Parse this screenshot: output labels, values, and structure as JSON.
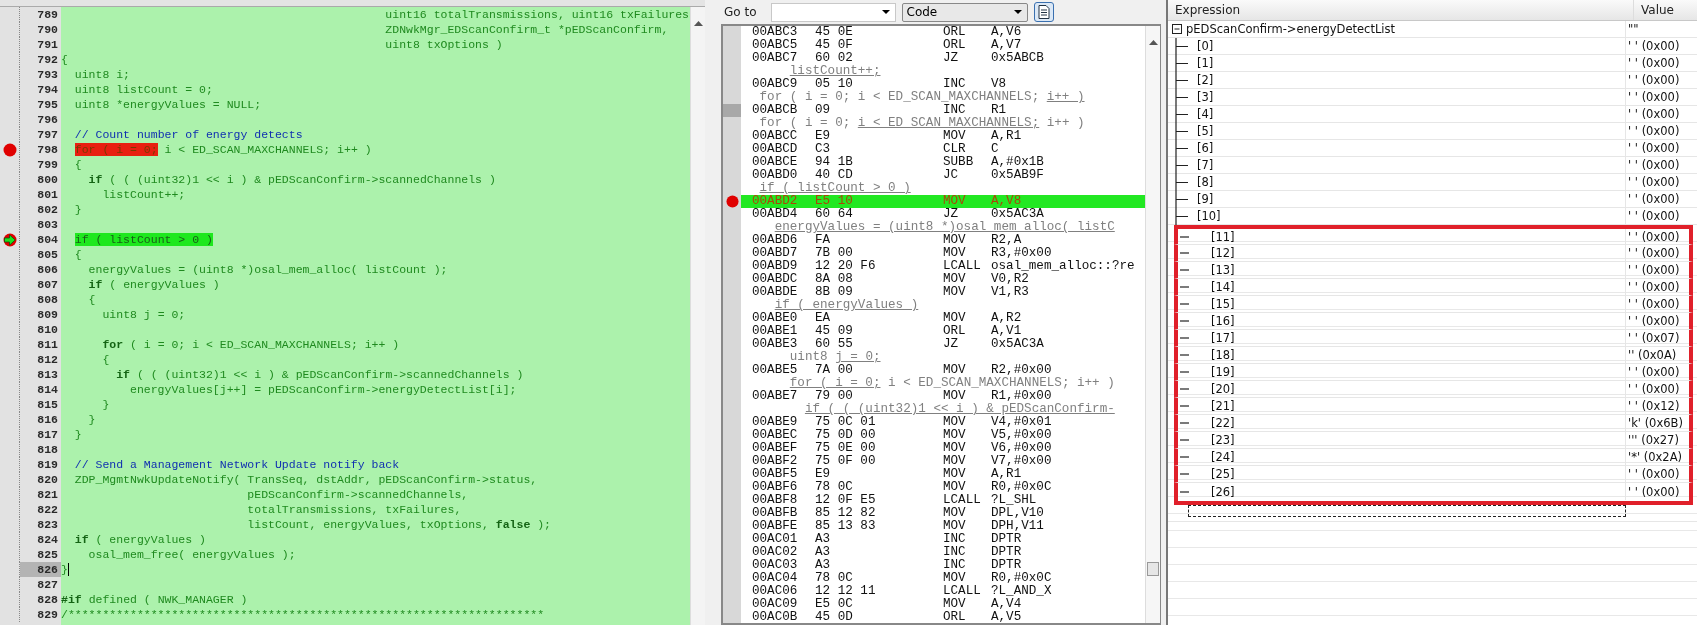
{
  "code": {
    "lines": [
      {
        "number": "789",
        "breakpoint": false,
        "current": false,
        "cursor": false,
        "segments": [
          {
            "kind": "plain",
            "text": "                                               uint16 totalTransmissions, uint16 txFailures"
          }
        ]
      },
      {
        "number": "790",
        "breakpoint": false,
        "current": false,
        "cursor": false,
        "segments": [
          {
            "kind": "plain",
            "text": "                                               ZDNwkMgr_EDScanConfirm_t *pEDScanConfirm,"
          }
        ]
      },
      {
        "number": "791",
        "breakpoint": false,
        "current": false,
        "cursor": false,
        "segments": [
          {
            "kind": "plain",
            "text": "                                               uint8 txOptions )"
          }
        ]
      },
      {
        "number": "792",
        "breakpoint": false,
        "current": false,
        "cursor": false,
        "segments": [
          {
            "kind": "plain",
            "text": "{"
          }
        ]
      },
      {
        "number": "793",
        "breakpoint": false,
        "current": false,
        "cursor": false,
        "segments": [
          {
            "kind": "plain",
            "text": "  uint8 i;"
          }
        ]
      },
      {
        "number": "794",
        "breakpoint": false,
        "current": false,
        "cursor": false,
        "segments": [
          {
            "kind": "plain",
            "text": "  uint8 listCount = 0;"
          }
        ]
      },
      {
        "number": "795",
        "breakpoint": false,
        "current": false,
        "cursor": false,
        "segments": [
          {
            "kind": "plain",
            "text": "  uint8 *energyValues = NULL;"
          }
        ]
      },
      {
        "number": "796",
        "breakpoint": false,
        "current": false,
        "cursor": false
      },
      {
        "number": "797",
        "breakpoint": false,
        "current": false,
        "cursor": false,
        "segments": [
          {
            "kind": "comment",
            "text": "  // Count number of energy detects"
          }
        ]
      },
      {
        "number": "798",
        "breakpoint": true,
        "current": false,
        "cursor": false,
        "segments": [
          {
            "kind": "breakpoint",
            "text": "  for ( i = 0;"
          },
          {
            "kind": "plain",
            "text": " i < ED_SCAN_MAXCHANNELS; i++ )"
          }
        ]
      },
      {
        "number": "799",
        "breakpoint": false,
        "current": false,
        "cursor": false,
        "segments": [
          {
            "kind": "plain",
            "text": "  {"
          }
        ]
      },
      {
        "number": "800",
        "breakpoint": false,
        "current": false,
        "cursor": false,
        "segments": [
          {
            "kind": "keyword",
            "text": "    if"
          },
          {
            "kind": "plain",
            "text": " ( ( (uint32)1 << i ) & pEDScanConfirm->scannedChannels )"
          }
        ]
      },
      {
        "number": "801",
        "breakpoint": false,
        "current": false,
        "cursor": false,
        "segments": [
          {
            "kind": "plain",
            "text": "      listCount++;"
          }
        ]
      },
      {
        "number": "802",
        "breakpoint": false,
        "current": false,
        "cursor": false,
        "segments": [
          {
            "kind": "plain",
            "text": "  }"
          }
        ]
      },
      {
        "number": "803",
        "breakpoint": false,
        "current": false,
        "cursor": false
      },
      {
        "number": "804",
        "breakpoint": true,
        "current": true,
        "cursor": false,
        "segments": [
          {
            "kind": "current",
            "text": "  if ( listCount > 0 )"
          }
        ]
      },
      {
        "number": "805",
        "breakpoint": false,
        "current": false,
        "cursor": false,
        "segments": [
          {
            "kind": "plain",
            "text": "  {"
          }
        ]
      },
      {
        "number": "806",
        "breakpoint": false,
        "current": false,
        "cursor": false,
        "segments": [
          {
            "kind": "plain",
            "text": "    energyValues = (uint8 *)osal_mem_alloc( listCount );"
          }
        ]
      },
      {
        "number": "807",
        "breakpoint": false,
        "current": false,
        "cursor": false,
        "segments": [
          {
            "kind": "keyword",
            "text": "    if"
          },
          {
            "kind": "plain",
            "text": " ( energyValues )"
          }
        ]
      },
      {
        "number": "808",
        "breakpoint": false,
        "current": false,
        "cursor": false,
        "segments": [
          {
            "kind": "plain",
            "text": "    {"
          }
        ]
      },
      {
        "number": "809",
        "breakpoint": false,
        "current": false,
        "cursor": false,
        "segments": [
          {
            "kind": "plain",
            "text": "      uint8 j = 0;"
          }
        ]
      },
      {
        "number": "810",
        "breakpoint": false,
        "current": false,
        "cursor": false
      },
      {
        "number": "811",
        "breakpoint": false,
        "current": false,
        "cursor": false,
        "segments": [
          {
            "kind": "keyword",
            "text": "      for"
          },
          {
            "kind": "plain",
            "text": " ( i = 0; i < ED_SCAN_MAXCHANNELS; i++ )"
          }
        ]
      },
      {
        "number": "812",
        "breakpoint": false,
        "current": false,
        "cursor": false,
        "segments": [
          {
            "kind": "plain",
            "text": "      {"
          }
        ]
      },
      {
        "number": "813",
        "breakpoint": false,
        "current": false,
        "cursor": false,
        "segments": [
          {
            "kind": "keyword",
            "text": "        if"
          },
          {
            "kind": "plain",
            "text": " ( ( (uint32)1 << i ) & pEDScanConfirm->scannedChannels )"
          }
        ]
      },
      {
        "number": "814",
        "breakpoint": false,
        "current": false,
        "cursor": false,
        "segments": [
          {
            "kind": "plain",
            "text": "          energyValues[j++] = pEDScanConfirm->energyDetectList[i];"
          }
        ]
      },
      {
        "number": "815",
        "breakpoint": false,
        "current": false,
        "cursor": false,
        "segments": [
          {
            "kind": "plain",
            "text": "      }"
          }
        ]
      },
      {
        "number": "816",
        "breakpoint": false,
        "current": false,
        "cursor": false,
        "segments": [
          {
            "kind": "plain",
            "text": "    }"
          }
        ]
      },
      {
        "number": "817",
        "breakpoint": false,
        "current": false,
        "cursor": false,
        "segments": [
          {
            "kind": "plain",
            "text": "  }"
          }
        ]
      },
      {
        "number": "818",
        "breakpoint": false,
        "current": false,
        "cursor": false
      },
      {
        "number": "819",
        "breakpoint": false,
        "current": false,
        "cursor": false,
        "segments": [
          {
            "kind": "comment",
            "text": "  // Send a Management Network Update notify back"
          }
        ]
      },
      {
        "number": "820",
        "breakpoint": false,
        "current": false,
        "cursor": false,
        "segments": [
          {
            "kind": "plain",
            "text": "  ZDP_MgmtNwkUpdateNotify( TransSeq, dstAddr, pEDScanConfirm->status,"
          }
        ]
      },
      {
        "number": "821",
        "breakpoint": false,
        "current": false,
        "cursor": false,
        "segments": [
          {
            "kind": "plain",
            "text": "                           pEDScanConfirm->scannedChannels,"
          }
        ]
      },
      {
        "number": "822",
        "breakpoint": false,
        "current": false,
        "cursor": false,
        "segments": [
          {
            "kind": "plain",
            "text": "                           totalTransmissions, txFailures,"
          }
        ]
      },
      {
        "number": "823",
        "breakpoint": false,
        "current": false,
        "cursor": false,
        "segments": [
          {
            "kind": "plain",
            "text": "                           listCount, energyValues, txOptions, "
          },
          {
            "kind": "keyword",
            "text": "false"
          },
          {
            "kind": "plain",
            "text": " );"
          }
        ]
      },
      {
        "number": "824",
        "breakpoint": false,
        "current": false,
        "cursor": false,
        "segments": [
          {
            "kind": "keyword",
            "text": "  if"
          },
          {
            "kind": "plain",
            "text": " ( energyValues )"
          }
        ]
      },
      {
        "number": "825",
        "breakpoint": false,
        "current": false,
        "cursor": false,
        "segments": [
          {
            "kind": "plain",
            "text": "    osal_mem_free( energyValues );"
          }
        ]
      },
      {
        "number": "826",
        "breakpoint": false,
        "current": false,
        "cursor": true,
        "segments": [
          {
            "kind": "plain",
            "text": "}"
          }
        ]
      },
      {
        "number": "827",
        "breakpoint": false,
        "current": false,
        "cursor": false
      },
      {
        "number": "828",
        "breakpoint": false,
        "current": false,
        "cursor": false,
        "segments": [
          {
            "kind": "keyword",
            "text": "#if"
          },
          {
            "kind": "plain",
            "text": " defined ( NWK_MANAGER )"
          }
        ]
      },
      {
        "number": "829",
        "breakpoint": false,
        "current": false,
        "cursor": false,
        "segments": [
          {
            "kind": "plain",
            "text": "/*********************************************************************"
          }
        ]
      }
    ]
  },
  "disassembly": {
    "toolbar": {
      "goto_label": "Go to",
      "view": "Code"
    },
    "rows": [
      {
        "kind": "instruction",
        "address": "00ABC3",
        "bytes": "45 0E",
        "mnemonic": "ORL",
        "operand": "A,V6",
        "breakpoint": false,
        "current": false,
        "cursor": false
      },
      {
        "kind": "instruction",
        "address": "00ABC5",
        "bytes": "45 0F",
        "mnemonic": "ORL",
        "operand": "A,V7",
        "breakpoint": false,
        "current": false,
        "cursor": false
      },
      {
        "kind": "instruction",
        "address": "00ABC7",
        "bytes": "60 02",
        "mnemonic": "JZ",
        "operand": "0x5ABCB",
        "breakpoint": false,
        "current": false,
        "cursor": false
      },
      {
        "kind": "source",
        "segments": [
          {
            "text": "     listCount++;",
            "underlined": true
          }
        ]
      },
      {
        "kind": "instruction",
        "address": "00ABC9",
        "bytes": "05 10",
        "mnemonic": "INC",
        "operand": "V8",
        "breakpoint": false,
        "current": false,
        "cursor": false
      },
      {
        "kind": "source",
        "segments": [
          {
            "text": " for ( i = 0; i < ED_SCAN_MAXCHANNELS; ",
            "underlined": false
          },
          {
            "text": "i++ )",
            "underlined": true
          }
        ]
      },
      {
        "kind": "instruction",
        "address": "00ABCB",
        "bytes": "09",
        "mnemonic": "INC",
        "operand": "R1",
        "breakpoint": false,
        "current": false,
        "cursor": true
      },
      {
        "kind": "source",
        "segments": [
          {
            "text": " for ( i = 0; ",
            "underlined": false
          },
          {
            "text": "i < ED_SCAN_MAXCHANNELS;",
            "underlined": true
          },
          {
            "text": " i++ )",
            "underlined": false
          }
        ]
      },
      {
        "kind": "instruction",
        "address": "00ABCC",
        "bytes": "E9",
        "mnemonic": "MOV",
        "operand": "A,R1",
        "breakpoint": false,
        "current": false,
        "cursor": false
      },
      {
        "kind": "instruction",
        "address": "00ABCD",
        "bytes": "C3",
        "mnemonic": "CLR",
        "operand": "C",
        "breakpoint": false,
        "current": false,
        "cursor": false
      },
      {
        "kind": "instruction",
        "address": "00ABCE",
        "bytes": "94 1B",
        "mnemonic": "SUBB",
        "operand": "A,#0x1B",
        "breakpoint": false,
        "current": false,
        "cursor": false
      },
      {
        "kind": "instruction",
        "address": "00ABD0",
        "bytes": "40 CD",
        "mnemonic": "JC",
        "operand": "0x5AB9F",
        "breakpoint": false,
        "current": false,
        "cursor": false
      },
      {
        "kind": "source",
        "segments": [
          {
            "text": " if ( listCount > 0 )",
            "underlined": true
          }
        ]
      },
      {
        "kind": "instruction",
        "address": "00ABD2",
        "bytes": "E5 10",
        "mnemonic": "MOV",
        "operand": "A,V8",
        "breakpoint": true,
        "current": true,
        "cursor": false
      },
      {
        "kind": "instruction",
        "address": "00ABD4",
        "bytes": "60 64",
        "mnemonic": "JZ",
        "operand": "0x5AC3A",
        "breakpoint": false,
        "current": false,
        "cursor": false
      },
      {
        "kind": "source",
        "segments": [
          {
            "text": "   energyValues = (uint8 *)osal_mem_alloc( listC",
            "underlined": true
          }
        ]
      },
      {
        "kind": "instruction",
        "address": "00ABD6",
        "bytes": "FA",
        "mnemonic": "MOV",
        "operand": "R2,A",
        "breakpoint": false,
        "current": false,
        "cursor": false
      },
      {
        "kind": "instruction",
        "address": "00ABD7",
        "bytes": "7B 00",
        "mnemonic": "MOV",
        "operand": "R3,#0x00",
        "breakpoint": false,
        "current": false,
        "cursor": false
      },
      {
        "kind": "instruction",
        "address": "00ABD9",
        "bytes": "12 20 F6",
        "mnemonic": "LCALL",
        "operand": "osal_mem_alloc::?re",
        "breakpoint": false,
        "current": false,
        "cursor": false
      },
      {
        "kind": "instruction",
        "address": "00ABDC",
        "bytes": "8A 08",
        "mnemonic": "MOV",
        "operand": "V0,R2",
        "breakpoint": false,
        "current": false,
        "cursor": false
      },
      {
        "kind": "instruction",
        "address": "00ABDE",
        "bytes": "8B 09",
        "mnemonic": "MOV",
        "operand": "V1,R3",
        "breakpoint": false,
        "current": false,
        "cursor": false
      },
      {
        "kind": "source",
        "segments": [
          {
            "text": "   if ( energyValues )",
            "underlined": true
          }
        ]
      },
      {
        "kind": "instruction",
        "address": "00ABE0",
        "bytes": "EA",
        "mnemonic": "MOV",
        "operand": "A,R2",
        "breakpoint": false,
        "current": false,
        "cursor": false
      },
      {
        "kind": "instruction",
        "address": "00ABE1",
        "bytes": "45 09",
        "mnemonic": "ORL",
        "operand": "A,V1",
        "breakpoint": false,
        "current": false,
        "cursor": false
      },
      {
        "kind": "instruction",
        "address": "00ABE3",
        "bytes": "60 55",
        "mnemonic": "JZ",
        "operand": "0x5AC3A",
        "breakpoint": false,
        "current": false,
        "cursor": false
      },
      {
        "kind": "source",
        "segments": [
          {
            "text": "     uint8 ",
            "underlined": false
          },
          {
            "text": "j = 0;",
            "underlined": true
          }
        ]
      },
      {
        "kind": "instruction",
        "address": "00ABE5",
        "bytes": "7A 00",
        "mnemonic": "MOV",
        "operand": "R2,#0x00",
        "breakpoint": false,
        "current": false,
        "cursor": false
      },
      {
        "kind": "source",
        "segments": [
          {
            "text": "     for ( i = 0;",
            "underlined": true
          },
          {
            "text": " i < ED_SCAN_MAXCHANNELS; i++ )",
            "underlined": false
          }
        ]
      },
      {
        "kind": "instruction",
        "address": "00ABE7",
        "bytes": "79 00",
        "mnemonic": "MOV",
        "operand": "R1,#0x00",
        "breakpoint": false,
        "current": false,
        "cursor": false
      },
      {
        "kind": "source",
        "segments": [
          {
            "text": "       if ( ( (uint32)1 << i ) & pEDScanConfirm-",
            "underlined": true
          }
        ]
      },
      {
        "kind": "instruction",
        "address": "00ABE9",
        "bytes": "75 0C 01",
        "mnemonic": "MOV",
        "operand": "V4,#0x01",
        "breakpoint": false,
        "current": false,
        "cursor": false
      },
      {
        "kind": "instruction",
        "address": "00ABEC",
        "bytes": "75 0D 00",
        "mnemonic": "MOV",
        "operand": "V5,#0x00",
        "breakpoint": false,
        "current": false,
        "cursor": false
      },
      {
        "kind": "instruction",
        "address": "00ABEF",
        "bytes": "75 0E 00",
        "mnemonic": "MOV",
        "operand": "V6,#0x00",
        "breakpoint": false,
        "current": false,
        "cursor": false
      },
      {
        "kind": "instruction",
        "address": "00ABF2",
        "bytes": "75 0F 00",
        "mnemonic": "MOV",
        "operand": "V7,#0x00",
        "breakpoint": false,
        "current": false,
        "cursor": false
      },
      {
        "kind": "instruction",
        "address": "00ABF5",
        "bytes": "E9",
        "mnemonic": "MOV",
        "operand": "A,R1",
        "breakpoint": false,
        "current": false,
        "cursor": false
      },
      {
        "kind": "instruction",
        "address": "00ABF6",
        "bytes": "78 0C",
        "mnemonic": "MOV",
        "operand": "R0,#0x0C",
        "breakpoint": false,
        "current": false,
        "cursor": false
      },
      {
        "kind": "instruction",
        "address": "00ABF8",
        "bytes": "12 0F E5",
        "mnemonic": "LCALL",
        "operand": "?L_SHL",
        "breakpoint": false,
        "current": false,
        "cursor": false
      },
      {
        "kind": "instruction",
        "address": "00ABFB",
        "bytes": "85 12 82",
        "mnemonic": "MOV",
        "operand": "DPL,V10",
        "breakpoint": false,
        "current": false,
        "cursor": false
      },
      {
        "kind": "instruction",
        "address": "00ABFE",
        "bytes": "85 13 83",
        "mnemonic": "MOV",
        "operand": "DPH,V11",
        "breakpoint": false,
        "current": false,
        "cursor": false
      },
      {
        "kind": "instruction",
        "address": "00AC01",
        "bytes": "A3",
        "mnemonic": "INC",
        "operand": "DPTR",
        "breakpoint": false,
        "current": false,
        "cursor": false
      },
      {
        "kind": "instruction",
        "address": "00AC02",
        "bytes": "A3",
        "mnemonic": "INC",
        "operand": "DPTR",
        "breakpoint": false,
        "current": false,
        "cursor": false
      },
      {
        "kind": "instruction",
        "address": "00AC03",
        "bytes": "A3",
        "mnemonic": "INC",
        "operand": "DPTR",
        "breakpoint": false,
        "current": false,
        "cursor": false
      },
      {
        "kind": "instruction",
        "address": "00AC04",
        "bytes": "78 0C",
        "mnemonic": "MOV",
        "operand": "R0,#0x0C",
        "breakpoint": false,
        "current": false,
        "cursor": false
      },
      {
        "kind": "instruction",
        "address": "00AC06",
        "bytes": "12 12 11",
        "mnemonic": "LCALL",
        "operand": "?L_AND_X",
        "breakpoint": false,
        "current": false,
        "cursor": false
      },
      {
        "kind": "instruction",
        "address": "00AC09",
        "bytes": "E5 0C",
        "mnemonic": "MOV",
        "operand": "A,V4",
        "breakpoint": false,
        "current": false,
        "cursor": false
      },
      {
        "kind": "instruction",
        "address": "00AC0B",
        "bytes": "45 0D",
        "mnemonic": "ORL",
        "operand": "A,V5",
        "breakpoint": false,
        "current": false,
        "cursor": false
      }
    ]
  },
  "watch": {
    "columns": [
      "Expression",
      "Value"
    ],
    "items": [
      {
        "expression": "pEDScanConfirm->energyDetectList",
        "value": "\"\"",
        "expanded": true,
        "children": [
          {
            "expression": "[0]",
            "value": "' ' (0x00)",
            "highlighted": false
          },
          {
            "expression": "[1]",
            "value": "' ' (0x00)",
            "highlighted": false
          },
          {
            "expression": "[2]",
            "value": "' ' (0x00)",
            "highlighted": false
          },
          {
            "expression": "[3]",
            "value": "' ' (0x00)",
            "highlighted": false
          },
          {
            "expression": "[4]",
            "value": "' ' (0x00)",
            "highlighted": false
          },
          {
            "expression": "[5]",
            "value": "' ' (0x00)",
            "highlighted": false
          },
          {
            "expression": "[6]",
            "value": "' ' (0x00)",
            "highlighted": false
          },
          {
            "expression": "[7]",
            "value": "' ' (0x00)",
            "highlighted": false
          },
          {
            "expression": "[8]",
            "value": "' ' (0x00)",
            "highlighted": false
          },
          {
            "expression": "[9]",
            "value": "' ' (0x00)",
            "highlighted": false
          },
          {
            "expression": "[10]",
            "value": "' ' (0x00)",
            "highlighted": false
          },
          {
            "expression": "[11]",
            "value": "' ' (0x00)",
            "highlighted": true
          },
          {
            "expression": "[12]",
            "value": "' ' (0x00)",
            "highlighted": true
          },
          {
            "expression": "[13]",
            "value": "' ' (0x00)",
            "highlighted": true
          },
          {
            "expression": "[14]",
            "value": "' ' (0x00)",
            "highlighted": true
          },
          {
            "expression": "[15]",
            "value": "' ' (0x00)",
            "highlighted": true
          },
          {
            "expression": "[16]",
            "value": "' ' (0x00)",
            "highlighted": true
          },
          {
            "expression": "[17]",
            "value": "' ' (0x07)",
            "highlighted": true
          },
          {
            "expression": "[18]",
            "value": "'' (0x0A)",
            "highlighted": true
          },
          {
            "expression": "[19]",
            "value": "' ' (0x00)",
            "highlighted": true
          },
          {
            "expression": "[20]",
            "value": "' ' (0x00)",
            "highlighted": true
          },
          {
            "expression": "[21]",
            "value": "' ' (0x12)",
            "highlighted": true
          },
          {
            "expression": "[22]",
            "value": "'k' (0x6B)",
            "highlighted": true
          },
          {
            "expression": "[23]",
            "value": "''' (0x27)",
            "highlighted": true
          },
          {
            "expression": "[24]",
            "value": "'*' (0x2A)",
            "highlighted": true
          },
          {
            "expression": "[25]",
            "value": "' ' (0x00)",
            "highlighted": true
          },
          {
            "expression": "[26]",
            "value": "' ' (0x00)",
            "highlighted": true
          }
        ]
      }
    ]
  }
}
